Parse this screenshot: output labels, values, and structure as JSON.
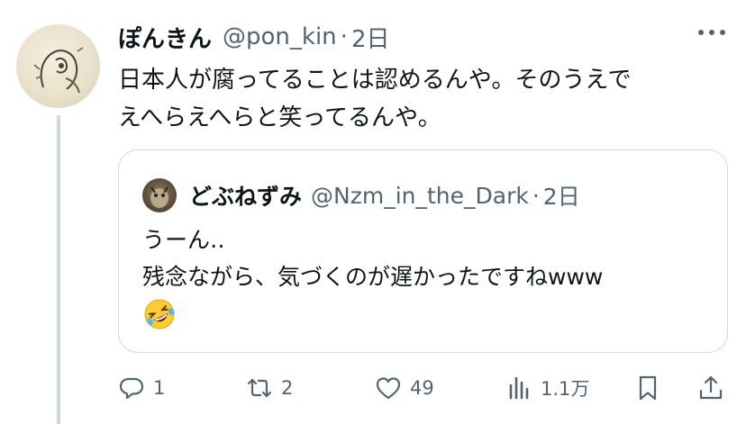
{
  "post": {
    "author_name": "ぽんきん",
    "author_handle": "@pon_kin",
    "separator": "·",
    "time": "2日",
    "text_lines": [
      "日本人が腐ってることは認めるんや。そのうえで",
      "えへらえへらと笑ってるんや。"
    ]
  },
  "quote": {
    "author_name": "どぶねずみ",
    "author_handle": "@Nzm_in_the_Dark",
    "separator": "·",
    "time": "2日",
    "text_lines": [
      "うーん‥",
      "残念ながら、気づくのが遅かったですねwww"
    ],
    "emoji": "rolling-on-floor-laughing"
  },
  "actions": {
    "reply_count": "1",
    "repost_count": "2",
    "like_count": "49",
    "views_count": "1.1万"
  },
  "colors": {
    "text": "#0f1419",
    "secondary": "#536471",
    "border": "#cfd9de",
    "thread_line": "#cfd9de"
  }
}
